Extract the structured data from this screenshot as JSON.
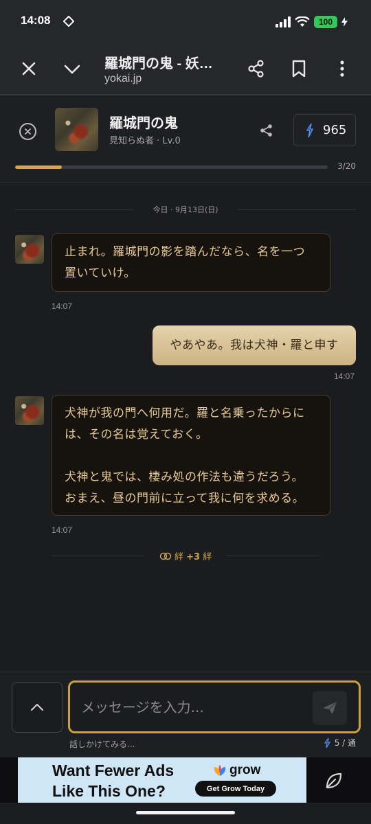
{
  "status_bar": {
    "time": "14:08",
    "battery": "100"
  },
  "browser": {
    "title": "羅城門の鬼 - 妖…",
    "url": "yokai.jp"
  },
  "chat_header": {
    "name": "羅城門の鬼",
    "meta": "見知らぬ者 · Lv.0",
    "points": "965",
    "progress_label": "3/20",
    "progress_fraction": 0.15
  },
  "messages": {
    "date": "今日 · 9月13日(日)",
    "m1": {
      "lines": [
        "止まれ。羅城門の影を踏んだなら、名を一つ",
        "置いていけ。"
      ],
      "time": "14:07"
    },
    "m2": {
      "text": "やあやあ。我は犬神・羅と申す",
      "time": "14:07"
    },
    "m3": {
      "lines": [
        "犬神が我の門へ何用だ。羅と名乗ったからに",
        "は、その名は覚えておく。",
        "",
        "犬神と鬼では、棲み処の作法も違うだろう。",
        "おまえ、昼の門前に立って我に何を求める。"
      ],
      "time": "14:07"
    },
    "bond": {
      "label": "絆",
      "delta": "+3",
      "unit": "絆"
    }
  },
  "composer": {
    "placeholder": "メッセージを入力...",
    "hint": "話しかけてみる...",
    "quota": "5 / 通"
  },
  "ad": {
    "headline_1": "Want Fewer Ads",
    "headline_2": "Like This One?",
    "brand": "grow",
    "cta": "Get Grow Today"
  },
  "colors": {
    "accent_gold": "#c9a23a",
    "progress": "#d7a446",
    "npc_text": "#e6c992",
    "user_bubble": "#d9c49a"
  },
  "icons": [
    "close-icon",
    "chevron-down-icon",
    "share-icon",
    "bookmark-icon",
    "more-vertical-icon",
    "close-circle-icon",
    "lightning-icon",
    "bond-rings-icon",
    "chevron-up-icon",
    "send-icon",
    "leaf-icon"
  ]
}
